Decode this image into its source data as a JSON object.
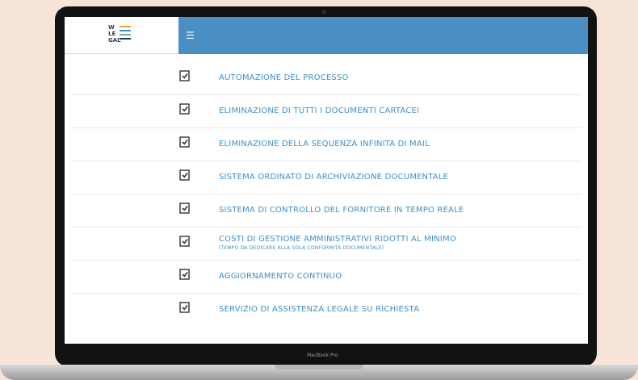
{
  "app": {
    "logo_text": "W LE GAL",
    "menu_icon": "hamburger-icon"
  },
  "features": [
    {
      "label": "AUTOMAZIONE DEL PROCESSO",
      "sub": ""
    },
    {
      "label": "ELIMINAZIONE DI TUTTI I DOCUMENTI CARTACEI",
      "sub": ""
    },
    {
      "label": "ELIMINAZIONE DELLA SEQUENZA INFINITA DI MAIL",
      "sub": ""
    },
    {
      "label": "SISTEMA ORDINATO DI ARCHIVIAZIONE DOCUMENTALE",
      "sub": ""
    },
    {
      "label": "SISTEMA DI CONTROLLO DEL FORNITORE IN TEMPO REALE",
      "sub": ""
    },
    {
      "label": "COSTI DI GESTIONE AMMINISTRATIVI RIDOTTI AL MINIMO",
      "sub": "(TEMPO DA DEDICARE ALLA SOLA CONFORMITÀ DOCUMENTALE)"
    },
    {
      "label": "AGGIORNAMENTO CONTINUO",
      "sub": ""
    },
    {
      "label": "SERVIZIO DI ASSISTENZA LEGALE SU RICHIESTA",
      "sub": ""
    }
  ],
  "device": {
    "label": "MacBook Pro"
  },
  "colors": {
    "header": "#4a8fc4",
    "accent_text": "#3f8fc7",
    "background": "#f7e4d9"
  }
}
